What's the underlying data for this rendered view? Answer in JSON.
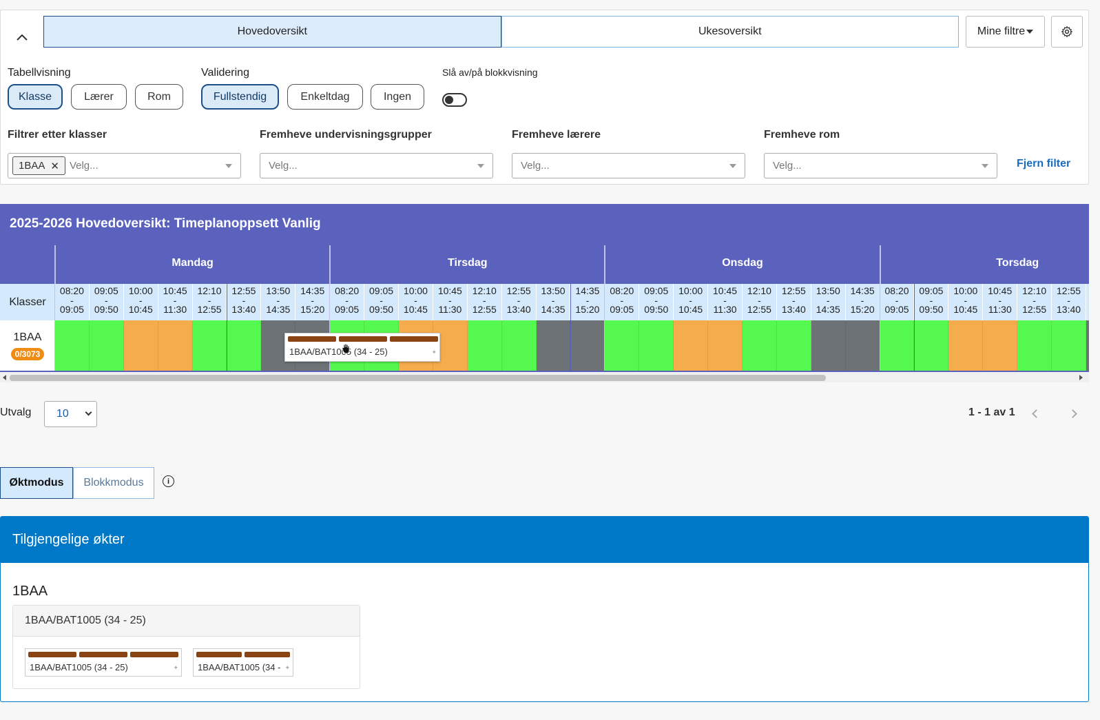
{
  "tabs": {
    "main": "Hovedoversikt",
    "week": "Ukesoversikt"
  },
  "my_filters": "Mine filtre",
  "table_view": {
    "label": "Tabellvisning",
    "options": [
      "Klasse",
      "Lærer",
      "Rom"
    ],
    "selected": "Klasse"
  },
  "validation": {
    "label": "Validering",
    "options": [
      "Fullstendig",
      "Enkeltdag",
      "Ingen"
    ],
    "selected": "Fullstendig"
  },
  "block_toggle": {
    "label": "Slå av/på blokkvisning",
    "on": false
  },
  "filters": {
    "classes": {
      "label": "Filtrer etter klasser",
      "chip": "1BAA",
      "placeholder": "Velg..."
    },
    "groups": {
      "label": "Fremheve undervisningsgrupper",
      "placeholder": "Velg..."
    },
    "teachers": {
      "label": "Fremheve lærere",
      "placeholder": "Velg..."
    },
    "rooms": {
      "label": "Fremheve rom",
      "placeholder": "Velg..."
    },
    "clear": "Fjern filter"
  },
  "grid": {
    "title": "2025-2026 Hovedoversikt: Timeplanoppsett Vanlig",
    "row_header": "Klasser",
    "days": [
      "Mandag",
      "Tirsdag",
      "Onsdag",
      "Torsdag"
    ],
    "slots": [
      {
        "start": "08:20",
        "end": "09:05"
      },
      {
        "start": "09:05",
        "end": "09:50"
      },
      {
        "start": "10:00",
        "end": "10:45"
      },
      {
        "start": "10:45",
        "end": "11:30"
      },
      {
        "start": "12:10",
        "end": "12:55"
      },
      {
        "start": "12:55",
        "end": "13:40"
      },
      {
        "start": "13:50",
        "end": "14:35"
      },
      {
        "start": "14:35",
        "end": "15:20"
      }
    ],
    "row": {
      "name": "1BAA",
      "badge": "0/3073"
    },
    "status_colors": {
      "free": "#55f84e",
      "partial": "#f5ac4c",
      "blocked": "#6c7275"
    },
    "cells": [
      [
        "free",
        "free",
        "partial",
        "partial",
        "free",
        "free",
        "blocked",
        "blocked"
      ],
      [
        "free",
        "free",
        "partial",
        "partial",
        "free",
        "free",
        "blocked",
        "blocked"
      ],
      [
        "free",
        "free",
        "partial",
        "partial",
        "free",
        "free",
        "blocked",
        "blocked"
      ],
      [
        "free",
        "free",
        "partial",
        "partial",
        "free",
        "free",
        "blocked",
        "blocked"
      ]
    ],
    "drag_card": "1BAA/BAT1005 (34 - 25)"
  },
  "paging": {
    "label": "Utvalg",
    "page_size": "10",
    "info": "1 - 1 av 1"
  },
  "modes": {
    "session": "Øktmodus",
    "block": "Blokkmodus",
    "active": "Øktmodus"
  },
  "available": {
    "title": "Tilgjengelige økter",
    "class": "1BAA",
    "group": "1BAA/BAT1005 (34 - 25)",
    "cards": [
      "1BAA/BAT1005 (34 - 25)",
      "1BAA/BAT1005 (34 -"
    ]
  },
  "colors": {
    "grid_header": "#5a62bd",
    "slot_header": "#d4e9fb",
    "available_header": "#0078c8",
    "accent_link": "#1a6cc2",
    "session_bar": "#8a4313"
  }
}
